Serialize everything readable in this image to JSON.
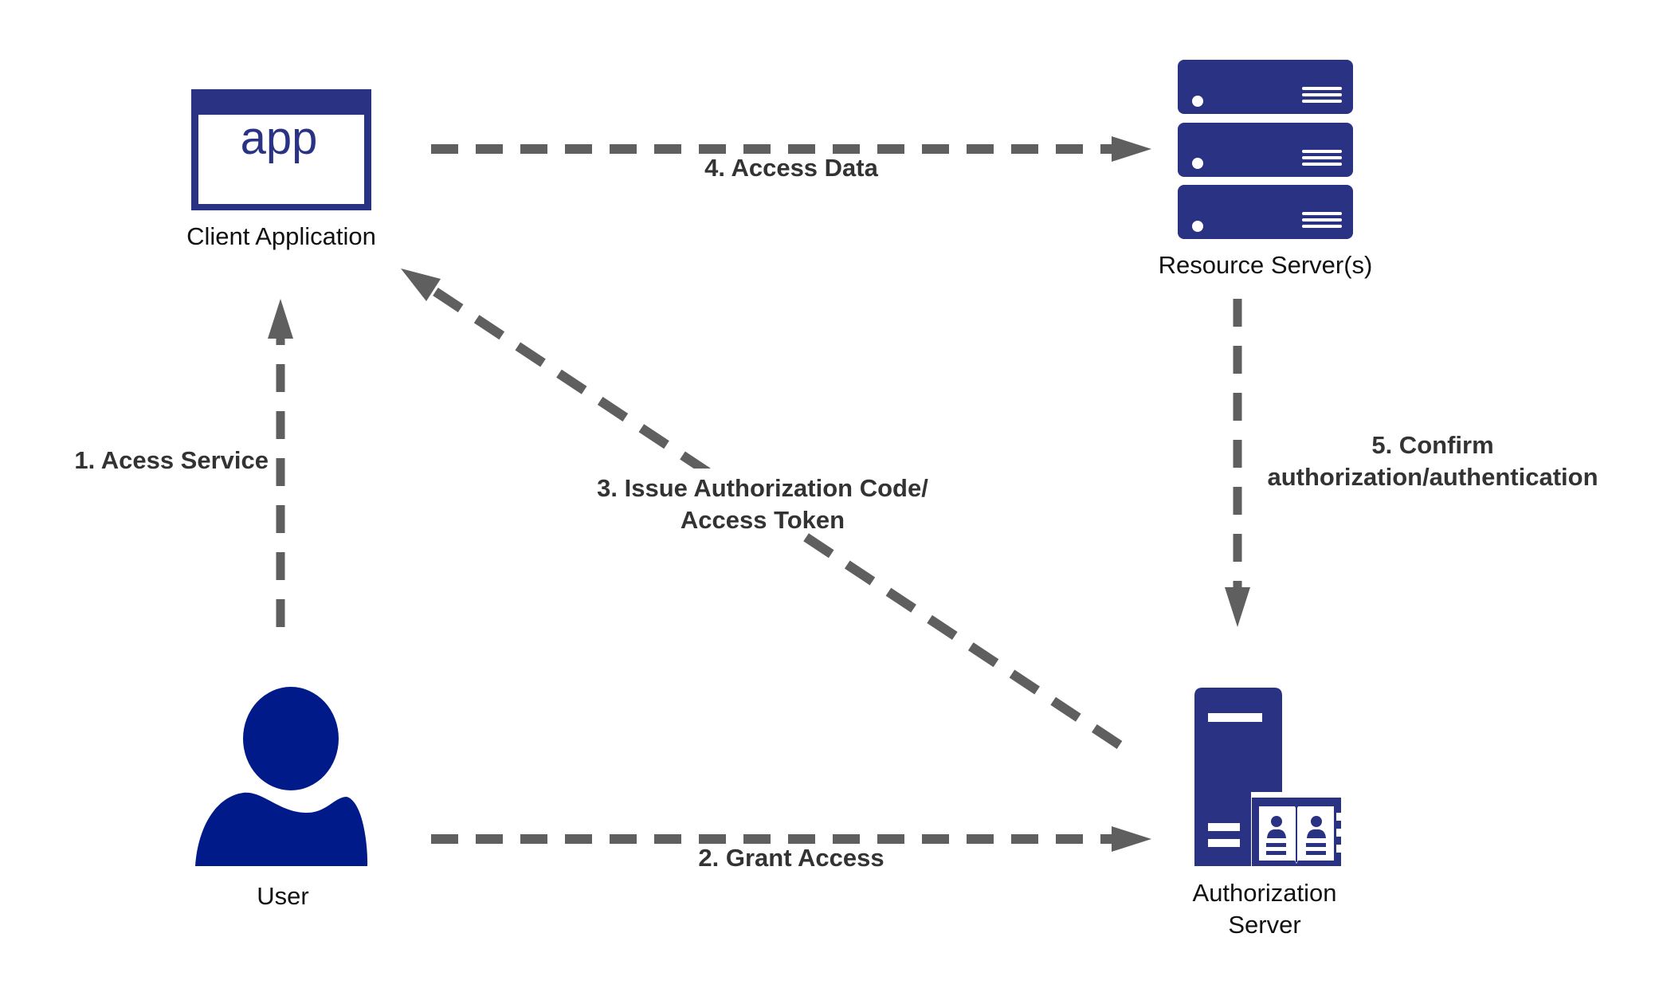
{
  "colors": {
    "icon_primary": "#2a3383",
    "user_icon": "#011a8a",
    "arrow": "#5f5f5f",
    "edge_label": "#333333",
    "node_label": "#111111",
    "background": "#ffffff"
  },
  "nodes": {
    "client_application": {
      "label": "Client Application",
      "icon": "app-window-icon",
      "icon_text": "app"
    },
    "resource_server": {
      "label": "Resource Server(s)",
      "icon": "server-stack-icon"
    },
    "user": {
      "label": "User",
      "icon": "user-icon"
    },
    "authorization_server": {
      "label_line1": "Authorization",
      "label_line2": "Server",
      "icon": "server-tower-with-directory-icon"
    }
  },
  "edges": [
    {
      "id": "access-service",
      "from": "user",
      "to": "client_application",
      "label": "1. Acess Service"
    },
    {
      "id": "grant-access",
      "from": "user",
      "to": "authorization_server",
      "label": "2. Grant Access"
    },
    {
      "id": "issue-token",
      "from": "authorization_server",
      "to": "client_application",
      "label_line1": "3. Issue Authorization Code/",
      "label_line2": "Access Token"
    },
    {
      "id": "access-data",
      "from": "client_application",
      "to": "resource_server",
      "label": "4. Access Data"
    },
    {
      "id": "confirm-auth",
      "from": "resource_server",
      "to": "authorization_server",
      "label_line1": "5. Confirm",
      "label_line2": "authorization/authentication"
    }
  ]
}
